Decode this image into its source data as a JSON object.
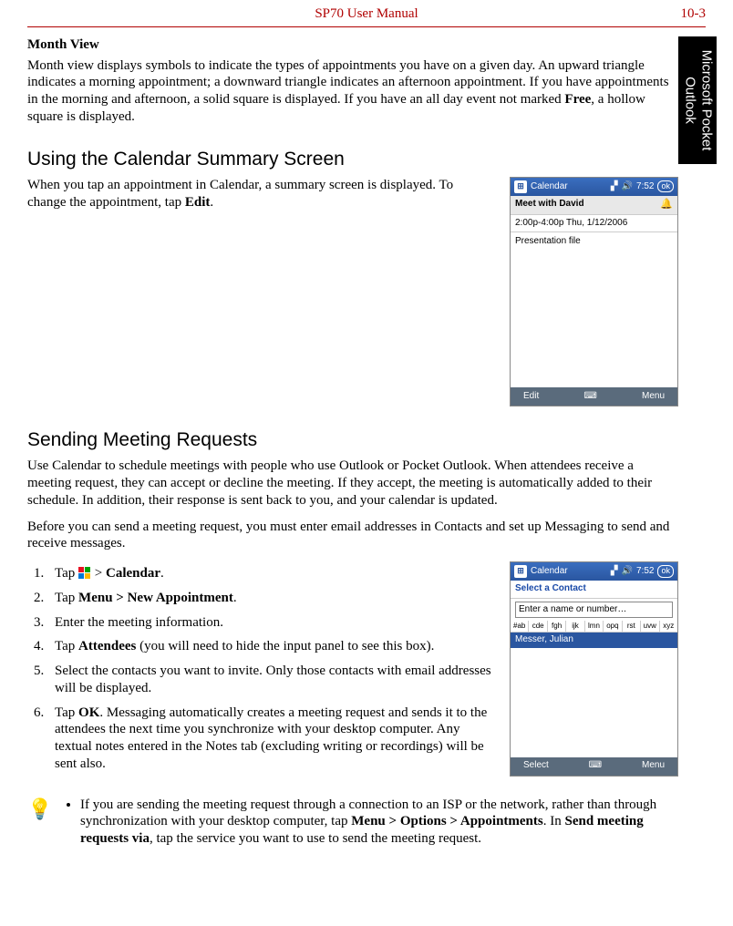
{
  "header": {
    "title": "SP70 User Manual",
    "page": "10-3"
  },
  "sideTab": {
    "line1": "Microsoft Pocket",
    "line2": "Outlook"
  },
  "monthView": {
    "heading": "Month View",
    "para_a": "Month view displays symbols to indicate the types of appointments you have on a given day. An upward triangle indicates a morning appointment; a downward triangle indicates an afternoon appointment. If you have appointments in the morning and afternoon, a solid square is displayed. If you have an all day event not marked ",
    "para_b": "Free",
    "para_c": ", a hollow square is displayed."
  },
  "summary": {
    "heading": "Using the Calendar Summary Screen",
    "para_a": "When you tap an appointment in Calendar, a summary screen is displayed. To change the appointment, tap ",
    "para_b": "Edit",
    "para_c": "."
  },
  "shot1": {
    "title": "Calendar",
    "time": "7:52",
    "ok": "ok",
    "subject": "Meet with David",
    "when": "2:00p-4:00p Thu, 1/12/2006",
    "note": "Presentation file",
    "softLeft": "Edit",
    "softRight": "Menu"
  },
  "meeting": {
    "heading": "Sending Meeting Requests",
    "p1": "Use Calendar to schedule meetings with people who use Outlook or Pocket Outlook. When attendees receive a meeting request, they can accept or decline the meeting. If they accept, the meeting is automatically added to their schedule. In addition, their response is sent back to you, and your calendar is updated.",
    "p2": "Before you can send a meeting request, you must enter email addresses in Contacts and set up Messaging to send and receive messages.",
    "step1_a": "Tap ",
    "step1_b": " > ",
    "step1_c": "Calendar",
    "step1_d": ".",
    "step2_a": "Tap ",
    "step2_b": "Menu > New Appointment",
    "step2_c": ".",
    "step3": "Enter the meeting information.",
    "step4_a": "Tap ",
    "step4_b": "Attendees",
    "step4_c": " (you will need to hide the input panel to see this box).",
    "step5": "Select the contacts you want to invite. Only those contacts with email addresses will be displayed.",
    "step6_a": "Tap ",
    "step6_b": "OK",
    "step6_c": ". Messaging automatically creates a meeting request and sends it to the attendees the next time you synchronize with your desktop computer. Any textual notes entered in the Notes tab (excluding writing or recordings) will be sent also."
  },
  "shot2": {
    "title": "Calendar",
    "time": "7:52",
    "ok": "ok",
    "select": "Select a Contact",
    "input": "Enter a name or number…",
    "alpha": [
      "#ab",
      "cde",
      "fgh",
      "ijk",
      "lmn",
      "opq",
      "rst",
      "uvw",
      "xyz"
    ],
    "row": "Messer, Julian",
    "softLeft": "Select",
    "softRight": "Menu"
  },
  "note": {
    "a": "If you are sending the meeting request through a connection to an ISP or the network, rather than through synchronization with your desktop computer, tap ",
    "b": "Menu > Options > Appointments",
    "c": ". In ",
    "d": "Send meeting requests via",
    "e": ", tap the service you want to use to send the meeting request."
  }
}
